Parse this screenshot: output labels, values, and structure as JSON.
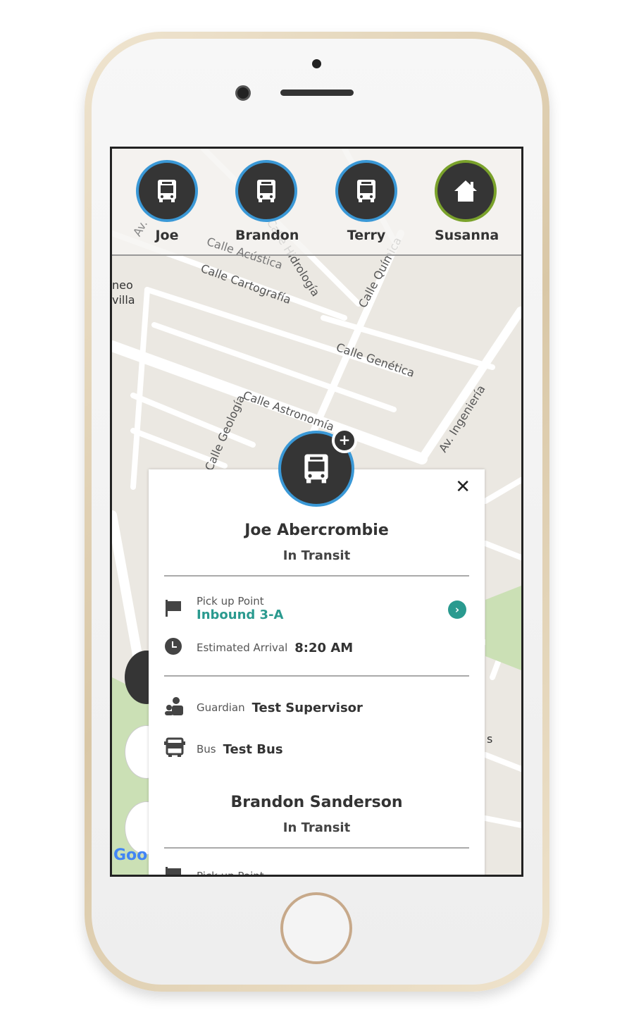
{
  "colors": {
    "accent_blue": "#3a98d6",
    "home_green": "#7aa22b",
    "teal": "#2a9a8f",
    "dark": "#353535"
  },
  "avatars": [
    {
      "name": "Joe",
      "icon": "bus-icon"
    },
    {
      "name": "Brandon",
      "icon": "bus-icon"
    },
    {
      "name": "Terry",
      "icon": "bus-icon"
    },
    {
      "name": "Susanna",
      "icon": "home-icon"
    }
  ],
  "map": {
    "labels": [
      "Calle Acústica",
      "Calle Hidrología",
      "Calle Química",
      "Calle Cartografía",
      "Calle Genética",
      "Calle Astronomía",
      "Calle Geología",
      "Av. Ingeniería",
      "Av.",
      "neo",
      "villa",
      "s"
    ],
    "attribution": "Goo"
  },
  "detail": {
    "close_label": "✕",
    "students": [
      {
        "name": "Joe Abercrombie",
        "status": "In Transit",
        "pickup_label": "Pick up Point",
        "pickup_value": "Inbound 3-A",
        "arrival_label": "Estimated Arrival",
        "arrival_value": "8:20 AM",
        "guardian_label": "Guardian",
        "guardian_value": "Test Supervisor",
        "bus_label": "Bus",
        "bus_value": "Test Bus"
      },
      {
        "name": "Brandon Sanderson",
        "status": "In Transit",
        "pickup_label": "Pick up Point"
      }
    ]
  }
}
